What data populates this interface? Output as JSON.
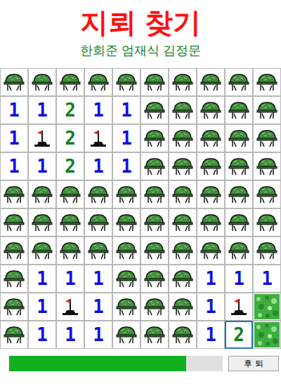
{
  "title": "지뢰 찾기",
  "subtitle": "한희준 엄재식 김정문",
  "board": {
    "rows": [
      [
        {
          "kind": "covered",
          "selected": false
        },
        {
          "kind": "covered",
          "selected": false
        },
        {
          "kind": "covered",
          "selected": false
        },
        {
          "kind": "covered",
          "selected": false
        },
        {
          "kind": "covered",
          "selected": false
        },
        {
          "kind": "covered",
          "selected": false
        },
        {
          "kind": "covered",
          "selected": false
        },
        {
          "kind": "covered",
          "selected": false
        },
        {
          "kind": "covered",
          "selected": false
        },
        {
          "kind": "covered",
          "selected": false
        }
      ],
      [
        {
          "kind": "number",
          "text": "1",
          "color": "#1010e0",
          "selected": false
        },
        {
          "kind": "number",
          "text": "1",
          "color": "#1010e0",
          "selected": false
        },
        {
          "kind": "number",
          "text": "2",
          "color": "#108020",
          "selected": false
        },
        {
          "kind": "number",
          "text": "1",
          "color": "#1010e0",
          "selected": false
        },
        {
          "kind": "number",
          "text": "1",
          "color": "#1010e0",
          "selected": false
        },
        {
          "kind": "covered",
          "selected": false
        },
        {
          "kind": "covered",
          "selected": false
        },
        {
          "kind": "covered",
          "selected": false
        },
        {
          "kind": "covered",
          "selected": false
        },
        {
          "kind": "covered",
          "selected": false
        }
      ],
      [
        {
          "kind": "number",
          "text": "1",
          "color": "#1010e0",
          "selected": false
        },
        {
          "kind": "flag",
          "selected": false
        },
        {
          "kind": "number",
          "text": "2",
          "color": "#108020",
          "selected": false
        },
        {
          "kind": "flag",
          "selected": false
        },
        {
          "kind": "number",
          "text": "1",
          "color": "#1010e0",
          "selected": false
        },
        {
          "kind": "covered",
          "selected": false
        },
        {
          "kind": "covered",
          "selected": false
        },
        {
          "kind": "covered",
          "selected": false
        },
        {
          "kind": "covered",
          "selected": false
        },
        {
          "kind": "covered",
          "selected": false
        }
      ],
      [
        {
          "kind": "number",
          "text": "1",
          "color": "#1010e0",
          "selected": false
        },
        {
          "kind": "number",
          "text": "1",
          "color": "#1010e0",
          "selected": false
        },
        {
          "kind": "number",
          "text": "2",
          "color": "#108020",
          "selected": false
        },
        {
          "kind": "number",
          "text": "1",
          "color": "#1010e0",
          "selected": false
        },
        {
          "kind": "number",
          "text": "1",
          "color": "#1010e0",
          "selected": false
        },
        {
          "kind": "covered",
          "selected": false
        },
        {
          "kind": "covered",
          "selected": false
        },
        {
          "kind": "covered",
          "selected": false
        },
        {
          "kind": "covered",
          "selected": false
        },
        {
          "kind": "covered",
          "selected": false
        }
      ],
      [
        {
          "kind": "covered",
          "selected": false
        },
        {
          "kind": "covered",
          "selected": false
        },
        {
          "kind": "covered",
          "selected": false
        },
        {
          "kind": "covered",
          "selected": false
        },
        {
          "kind": "covered",
          "selected": false
        },
        {
          "kind": "covered",
          "selected": false
        },
        {
          "kind": "covered",
          "selected": false
        },
        {
          "kind": "covered",
          "selected": false
        },
        {
          "kind": "covered",
          "selected": false
        },
        {
          "kind": "covered",
          "selected": false
        }
      ],
      [
        {
          "kind": "covered",
          "selected": false
        },
        {
          "kind": "covered",
          "selected": false
        },
        {
          "kind": "covered",
          "selected": false
        },
        {
          "kind": "covered",
          "selected": false
        },
        {
          "kind": "covered",
          "selected": false
        },
        {
          "kind": "covered",
          "selected": false
        },
        {
          "kind": "covered",
          "selected": false
        },
        {
          "kind": "covered",
          "selected": false
        },
        {
          "kind": "covered",
          "selected": false
        },
        {
          "kind": "covered",
          "selected": false
        }
      ],
      [
        {
          "kind": "covered",
          "selected": false
        },
        {
          "kind": "covered",
          "selected": false
        },
        {
          "kind": "covered",
          "selected": false
        },
        {
          "kind": "covered",
          "selected": false
        },
        {
          "kind": "covered",
          "selected": false
        },
        {
          "kind": "covered",
          "selected": false
        },
        {
          "kind": "covered",
          "selected": false
        },
        {
          "kind": "covered",
          "selected": false
        },
        {
          "kind": "covered",
          "selected": false
        },
        {
          "kind": "covered",
          "selected": false
        }
      ],
      [
        {
          "kind": "covered",
          "selected": false
        },
        {
          "kind": "number",
          "text": "1",
          "color": "#1010e0",
          "selected": false
        },
        {
          "kind": "number",
          "text": "1",
          "color": "#1010e0",
          "selected": false
        },
        {
          "kind": "number",
          "text": "1",
          "color": "#1010e0",
          "selected": false
        },
        {
          "kind": "covered",
          "selected": false
        },
        {
          "kind": "covered",
          "selected": false
        },
        {
          "kind": "covered",
          "selected": false
        },
        {
          "kind": "number",
          "text": "1",
          "color": "#1010e0",
          "selected": false
        },
        {
          "kind": "number",
          "text": "1",
          "color": "#1010e0",
          "selected": false
        },
        {
          "kind": "number",
          "text": "1",
          "color": "#1010e0",
          "selected": false
        }
      ],
      [
        {
          "kind": "covered",
          "selected": false
        },
        {
          "kind": "number",
          "text": "1",
          "color": "#1010e0",
          "selected": false
        },
        {
          "kind": "flag",
          "selected": false
        },
        {
          "kind": "number",
          "text": "1",
          "color": "#1010e0",
          "selected": false
        },
        {
          "kind": "covered",
          "selected": false
        },
        {
          "kind": "covered",
          "selected": false
        },
        {
          "kind": "covered",
          "selected": false
        },
        {
          "kind": "number",
          "text": "1",
          "color": "#1010e0",
          "selected": false
        },
        {
          "kind": "flag",
          "selected": false
        },
        {
          "kind": "bush",
          "selected": false
        }
      ],
      [
        {
          "kind": "covered",
          "selected": false
        },
        {
          "kind": "number",
          "text": "1",
          "color": "#1010e0",
          "selected": false
        },
        {
          "kind": "number",
          "text": "1",
          "color": "#1010e0",
          "selected": false
        },
        {
          "kind": "number",
          "text": "1",
          "color": "#1010e0",
          "selected": false
        },
        {
          "kind": "covered",
          "selected": false
        },
        {
          "kind": "covered",
          "selected": false
        },
        {
          "kind": "covered",
          "selected": false
        },
        {
          "kind": "number",
          "text": "1",
          "color": "#1010e0",
          "selected": false
        },
        {
          "kind": "number",
          "text": "2",
          "color": "#108020",
          "selected": true
        },
        {
          "kind": "bush",
          "selected": false
        }
      ]
    ]
  },
  "progress": {
    "level": 0.83
  },
  "buttons": [
    "후 퇴"
  ]
}
